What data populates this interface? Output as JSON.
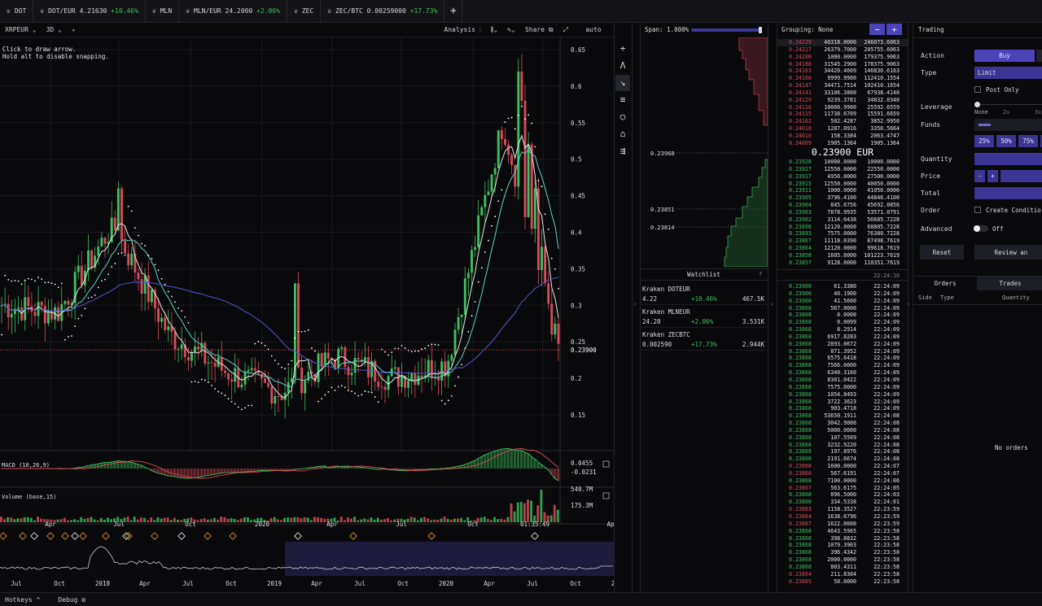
{
  "tabs": [
    {
      "icon": "crown",
      "label": "DOT",
      "price": "",
      "change": "",
      "dir": "pos"
    },
    {
      "icon": "crown",
      "label": "DOT/EUR 4.21630",
      "price": "",
      "change": "+10.46%",
      "dir": "pos"
    },
    {
      "icon": "crown",
      "label": "MLN",
      "price": "",
      "change": "",
      "dir": "pos"
    },
    {
      "icon": "crown",
      "label": "MLN/EUR 24.2000",
      "price": "",
      "change": "+2.06%",
      "dir": "pos"
    },
    {
      "icon": "crown",
      "label": "ZEC",
      "price": "",
      "change": "",
      "dir": "pos"
    },
    {
      "icon": "crown",
      "label": "ZEC/BTC 0.00259000",
      "price": "",
      "change": "+17.73%",
      "dir": "pos"
    }
  ],
  "plus_tab": "+",
  "chart": {
    "symbol": "XRPEUR",
    "interval": "3D",
    "star": "★",
    "analysis": "Analysis",
    "share": "Share",
    "auto": "auto",
    "hint1": "Click to draw arrow.",
    "hint2": "Hold alt to disable snapping.",
    "price_ticks": [
      "0.65",
      "0.6",
      "0.55",
      "0.5",
      "0.45",
      "0.4",
      "0.35",
      "0.3",
      "0.25",
      "0.2",
      "0.15"
    ],
    "last_price": "0.23900",
    "macd_label": "MACD (10,26,9)",
    "macd_v1": "0.0455",
    "macd_v2": "-0.0231",
    "vol_label": "Volume (base,15)",
    "vol_v1": "540.7M",
    "vol_v2": "175.3M",
    "time_ticks": [
      "Apr",
      "Jul",
      "Oct",
      "2020",
      "Apr",
      "Jul",
      "Oct",
      "01:35:49",
      "Ap"
    ],
    "nav_ticks": [
      "Jul",
      "Oct",
      "2018",
      "Apr",
      "Jul",
      "Oct",
      "2019",
      "Apr",
      "Jul",
      "Oct",
      "2020",
      "Apr",
      "Jul",
      "Oct",
      "2"
    ]
  },
  "chart_data": {
    "type": "line",
    "title": "XRPEUR 3D",
    "ylim": [
      0.12,
      0.67
    ],
    "x": [
      "2019-02",
      "2019-04",
      "2019-07",
      "2019-10",
      "2020-01",
      "2020-04",
      "2020-07",
      "2020-10",
      "2021-01",
      "2021-04",
      "2021-06"
    ],
    "series": [
      {
        "name": "XRPEUR",
        "values": [
          0.3,
          0.29,
          0.41,
          0.26,
          0.21,
          0.18,
          0.23,
          0.2,
          0.22,
          0.55,
          0.24
        ]
      }
    ]
  },
  "depth": {
    "label": "Span: 1.000%",
    "levels": [
      "0.23968",
      "0.23851",
      "0.23814"
    ]
  },
  "watchlist": {
    "title": "Watchlist",
    "help": "?",
    "items": [
      {
        "name": "Kraken DOTEUR",
        "price": "4.22",
        "change": "+10.46%",
        "vol": "467.5K"
      },
      {
        "name": "Kraken MLNEUR",
        "price": "24.20",
        "change": "+2.06%",
        "vol": "3.531K"
      },
      {
        "name": "Kraken ZECBTC",
        "price": "0.002590",
        "change": "+17.73%",
        "vol": "2.944K"
      }
    ]
  },
  "book": {
    "grouping": "Grouping: None",
    "minus": "−",
    "plus": "+",
    "mid": "0.23900 EUR",
    "trades_time": "22:24:10",
    "asks": [
      [
        "0.24229",
        "40318.0000",
        "246073.6063"
      ],
      [
        "0.24217",
        "26379.7000",
        "205755.6063"
      ],
      [
        "0.24200",
        "1000.0000",
        "179375.9063"
      ],
      [
        "0.24188",
        "31545.2900",
        "178375.9063"
      ],
      [
        "0.24163",
        "34420.4609",
        "146830.6163"
      ],
      [
        "0.24160",
        "9999.9900",
        "112410.1554"
      ],
      [
        "0.24147",
        "34471.7514",
        "102410.1654"
      ],
      [
        "0.24141",
        "33106.3800",
        "67938.4140"
      ],
      [
        "0.24129",
        "9239.3781",
        "34832.0340"
      ],
      [
        "0.24116",
        "10000.9900",
        "25592.6559"
      ],
      [
        "0.24115",
        "11738.6709",
        "15591.6659"
      ],
      [
        "0.24102",
        "502.4287",
        "3852.9950"
      ],
      [
        "0.24018",
        "1287.0916",
        "3350.5664"
      ],
      [
        "0.24010",
        "158.3384",
        "2063.4747"
      ],
      [
        "0.24009",
        "1905.1364",
        "1905.1364"
      ]
    ],
    "bids": [
      [
        "0.23928",
        "10000.0000",
        "10000.0000"
      ],
      [
        "0.23927",
        "12550.0000",
        "22550.0000"
      ],
      [
        "0.23917",
        "4950.0000",
        "27500.0000"
      ],
      [
        "0.23915",
        "12550.0000",
        "40050.0000"
      ],
      [
        "0.23911",
        "1000.0000",
        "41050.0000"
      ],
      [
        "0.23905",
        "3796.4100",
        "44846.4100"
      ],
      [
        "0.23904",
        "845.6756",
        "45692.0856"
      ],
      [
        "0.23903",
        "7878.9935",
        "53571.0791"
      ],
      [
        "0.23902",
        "3114.6438",
        "56685.7228"
      ],
      [
        "0.23896",
        "12120.0000",
        "68805.7228"
      ],
      [
        "0.23893",
        "7575.0000",
        "76380.7228"
      ],
      [
        "0.23867",
        "11118.0390",
        "87498.7619"
      ],
      [
        "0.23864",
        "12120.0000",
        "99618.7619"
      ],
      [
        "0.23858",
        "1605.0000",
        "101223.7619"
      ],
      [
        "0.23857",
        "9128.0000",
        "110351.7619"
      ]
    ],
    "trades": [
      [
        "0.23900",
        "61.3380",
        "22:24:09",
        "pos"
      ],
      [
        "0.23900",
        "40.1900",
        "22:24:09",
        "pos"
      ],
      [
        "0.23900",
        "41.5600",
        "22:24:09",
        "pos"
      ],
      [
        "0.23868",
        "567.0000",
        "22:24:09",
        "pos"
      ],
      [
        "0.23868",
        "0.0000",
        "22:24:09",
        "pos"
      ],
      [
        "0.23868",
        "0.0099",
        "22:24:09",
        "pos"
      ],
      [
        "0.23868",
        "8.2914",
        "22:24:09",
        "pos"
      ],
      [
        "0.23868",
        "6917.8283",
        "22:24:09",
        "pos"
      ],
      [
        "0.23868",
        "2893.0672",
        "22:24:09",
        "pos"
      ],
      [
        "0.23868",
        "871.3952",
        "22:24:09",
        "pos"
      ],
      [
        "0.23868",
        "6575.6418",
        "22:24:09",
        "pos"
      ],
      [
        "0.23868",
        "7566.0000",
        "22:24:09",
        "pos"
      ],
      [
        "0.23868",
        "6340.3160",
        "22:24:09",
        "pos"
      ],
      [
        "0.23868",
        "8301.0422",
        "22:24:09",
        "pos"
      ],
      [
        "0.23868",
        "7575.0000",
        "22:24:09",
        "pos"
      ],
      [
        "0.23868",
        "1054.8493",
        "22:24:09",
        "pos"
      ],
      [
        "0.23868",
        "3722.3623",
        "22:24:09",
        "pos"
      ],
      [
        "0.23868",
        "903.4718",
        "22:24:09",
        "pos"
      ],
      [
        "0.23868",
        "53650.1911",
        "22:24:08",
        "pos"
      ],
      [
        "0.23868",
        "3042.9000",
        "22:24:08",
        "pos"
      ],
      [
        "0.23868",
        "5000.0000",
        "22:24:08",
        "pos"
      ],
      [
        "0.23868",
        "107.5509",
        "22:24:08",
        "pos"
      ],
      [
        "0.23868",
        "3232.9220",
        "22:24:08",
        "pos"
      ],
      [
        "0.23868",
        "197.8976",
        "22:24:08",
        "pos"
      ],
      [
        "0.23868",
        "2191.6674",
        "22:24:08",
        "pos"
      ],
      [
        "0.23868",
        "1600.0000",
        "22:24:07",
        "neg"
      ],
      [
        "0.23868",
        "567.6191",
        "22:24:07",
        "neg"
      ],
      [
        "0.23868",
        "7100.0000",
        "22:24:06",
        "pos"
      ],
      [
        "0.23867",
        "563.6175",
        "22:24:05",
        "neg"
      ],
      [
        "0.23868",
        "896.5000",
        "22:24:03",
        "pos"
      ],
      [
        "0.23868",
        "334.5338",
        "22:24:01",
        "pos"
      ],
      [
        "0.23863",
        "1158.3527",
        "22:23:59",
        "neg"
      ],
      [
        "0.23864",
        "1638.6796",
        "22:23:59",
        "neg"
      ],
      [
        "0.23867",
        "1622.0000",
        "22:23:59",
        "neg"
      ],
      [
        "0.23868",
        "4643.5965",
        "22:23:58",
        "pos"
      ],
      [
        "0.23868",
        "398.8832",
        "22:23:58",
        "pos"
      ],
      [
        "0.23868",
        "1079.3903",
        "22:23:58",
        "pos"
      ],
      [
        "0.23868",
        "396.4342",
        "22:23:58",
        "pos"
      ],
      [
        "0.23868",
        "2000.0000",
        "22:23:58",
        "pos"
      ],
      [
        "0.23868",
        "803.4311",
        "22:23:58",
        "pos"
      ],
      [
        "0.23864",
        "211.8304",
        "22:23:58",
        "neg"
      ],
      [
        "0.23865",
        "50.0000",
        "22:23:58",
        "neg"
      ]
    ]
  },
  "trading": {
    "title": "Trading",
    "action_label": "Action",
    "buy": "Buy",
    "type_label": "Type",
    "type_value": "Limit",
    "post_only": "Post Only",
    "leverage_label": "Leverage",
    "lev_none": "None",
    "lev_2x": "2x",
    "lev_3x": "3x",
    "funds_label": "Funds",
    "pct": [
      "25%",
      "50%",
      "75%"
    ],
    "quantity_label": "Quantity",
    "price_label": "Price",
    "total_label": "Total",
    "order_label": "Order",
    "create_cond": "Create Conditio",
    "advanced_label": "Advanced",
    "advanced_value": "Off",
    "reset": "Reset",
    "review": "Review an",
    "orders_tab": "Orders",
    "trades_tab": "Trades",
    "col_side": "Side",
    "col_type": "Type",
    "col_qty": "Quantity",
    "no_orders": "No orders"
  },
  "bottom": {
    "hotkeys": "Hotkeys",
    "debug": "Debug"
  },
  "colors": {
    "accent": "#4c44b8",
    "green": "#3fbf5f",
    "red": "#d94a5a",
    "bg": "#0a0a0c"
  }
}
